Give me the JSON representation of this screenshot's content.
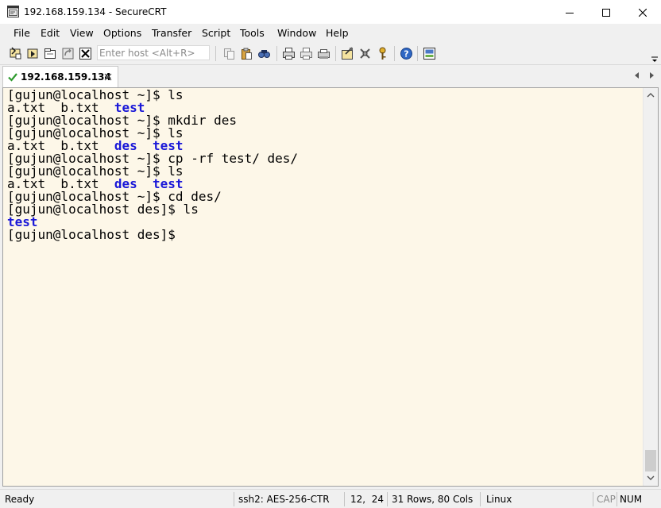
{
  "window": {
    "title": "192.168.159.134 - SecureCRT"
  },
  "menu": {
    "items": [
      "File",
      "Edit",
      "View",
      "Options",
      "Transfer",
      "Script",
      "Tools",
      "Window",
      "Help"
    ]
  },
  "toolbar": {
    "quick_connect_placeholder": "Enter host <Alt+R>",
    "icons": [
      "connect-icon",
      "quick-connect-icon",
      "connect-in-tab-icon",
      "reconnect-icon",
      "disconnect-icon",
      "copy-icon",
      "paste-icon",
      "find-icon",
      "print-icon",
      "print-selection-icon",
      "print-setup-icon",
      "session-options-icon",
      "global-options-icon",
      "keymap-icon",
      "help-icon",
      "sftp-icon"
    ]
  },
  "tabs": [
    {
      "label": "192.168.159.134",
      "status": "connected"
    }
  ],
  "terminal": {
    "lines": [
      {
        "text": "[gujun@localhost ~]$ ls"
      },
      {
        "parts": [
          {
            "text": "a.txt  b.txt  "
          },
          {
            "text": "test",
            "dir": true
          }
        ]
      },
      {
        "text": "[gujun@localhost ~]$ mkdir des"
      },
      {
        "text": "[gujun@localhost ~]$ ls"
      },
      {
        "parts": [
          {
            "text": "a.txt  b.txt  "
          },
          {
            "text": "des",
            "dir": true
          },
          {
            "text": "  "
          },
          {
            "text": "test",
            "dir": true
          }
        ]
      },
      {
        "text": "[gujun@localhost ~]$ cp -rf test/ des/"
      },
      {
        "text": "[gujun@localhost ~]$ ls"
      },
      {
        "parts": [
          {
            "text": "a.txt  b.txt  "
          },
          {
            "text": "des",
            "dir": true
          },
          {
            "text": "  "
          },
          {
            "text": "test",
            "dir": true
          }
        ]
      },
      {
        "text": "[gujun@localhost ~]$ cd des/"
      },
      {
        "text": "[gujun@localhost des]$ ls"
      },
      {
        "parts": [
          {
            "text": "test",
            "dir": true
          }
        ]
      },
      {
        "text": "[gujun@localhost des]$"
      }
    ],
    "colors": {
      "background": "#fdf7e8",
      "text": "#000000",
      "directory": "#1a18d8"
    }
  },
  "statusbar": {
    "ready": "Ready",
    "cipher": "ssh2: AES-256-CTR",
    "cursor": "12,  24",
    "size": "31 Rows, 80 Cols",
    "terminal_type": "Linux",
    "cap": "CAP",
    "num": "NUM"
  }
}
